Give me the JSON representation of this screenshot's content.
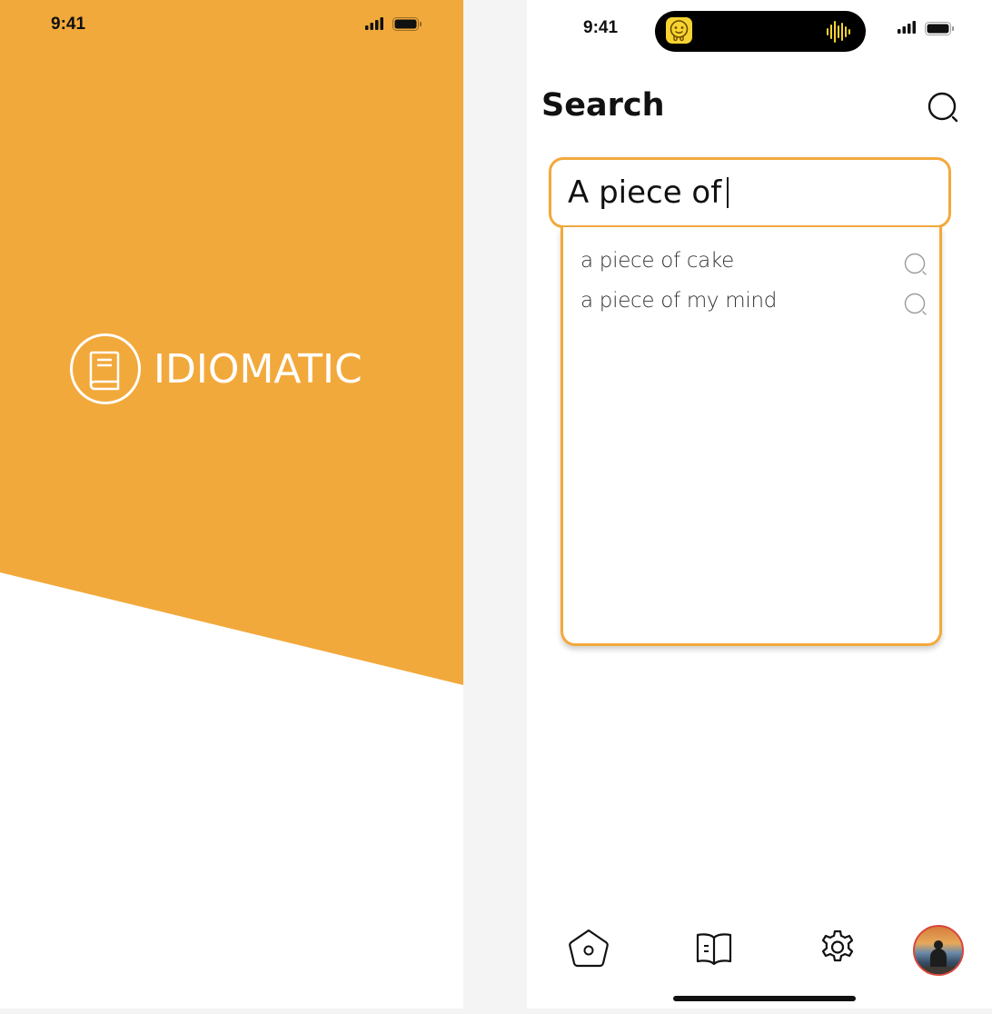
{
  "splash": {
    "status_time": "9:41",
    "brand_name": "IDIOMATIC",
    "logo_icon": "book-icon",
    "accent_color": "#F2A93B"
  },
  "search_screen": {
    "status_time": "9:41",
    "island_app_icon": "melting-smiley-icon",
    "island_activity_icon": "audio-waveform-icon",
    "header": {
      "title": "Search",
      "search_icon": "search-icon"
    },
    "search_input": {
      "value": "A piece of",
      "border_color": "#F2A93B"
    },
    "suggestions": [
      {
        "label": "a piece of cake",
        "icon": "search-icon"
      },
      {
        "label": "a piece of my mind",
        "icon": "search-icon"
      }
    ],
    "bottom_nav": [
      {
        "name": "home",
        "icon": "home-icon"
      },
      {
        "name": "library",
        "icon": "open-book-icon"
      },
      {
        "name": "settings",
        "icon": "gear-icon"
      },
      {
        "name": "profile",
        "icon": "avatar"
      }
    ]
  }
}
